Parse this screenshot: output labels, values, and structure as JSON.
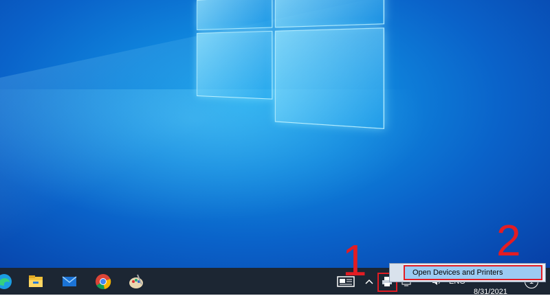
{
  "desktop": {
    "background_color": "#0f86dd"
  },
  "taskbar": {
    "background_color": "#1c2633",
    "pinned_apps": [
      {
        "name": "edge-icon"
      },
      {
        "name": "file-explorer-icon"
      },
      {
        "name": "mail-icon"
      },
      {
        "name": "chrome-icon"
      },
      {
        "name": "paint-icon"
      }
    ],
    "tray": {
      "news_icon": "news-and-interests-icon",
      "overflow_icon": "chevron-up-icon",
      "printer_icon": "printer-icon",
      "language": "ENG",
      "date": "8/31/2021",
      "notification_count": "1"
    }
  },
  "context_menu": {
    "item_label": "Open Devices and Printers"
  },
  "annotations": {
    "step1": "1",
    "step2": "2",
    "color": "#e31c23"
  }
}
